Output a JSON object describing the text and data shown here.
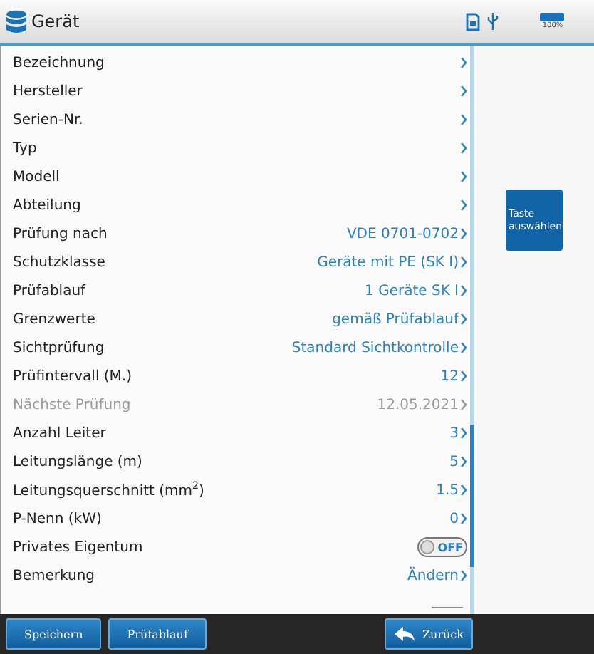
{
  "header": {
    "title": "Gerät",
    "battery": "100%"
  },
  "rows": [
    {
      "kind": "link",
      "label": "Bezeichnung",
      "value": "",
      "disabled": false
    },
    {
      "kind": "link",
      "label": "Hersteller",
      "value": "",
      "disabled": false
    },
    {
      "kind": "link",
      "label": "Serien-Nr.",
      "value": "",
      "disabled": false
    },
    {
      "kind": "link",
      "label": "Typ",
      "value": "",
      "disabled": false
    },
    {
      "kind": "link",
      "label": "Modell",
      "value": "",
      "disabled": false
    },
    {
      "kind": "link",
      "label": "Abteilung",
      "value": "",
      "disabled": false
    },
    {
      "kind": "link",
      "label": "Prüfung nach",
      "value": "VDE 0701-0702",
      "disabled": false
    },
    {
      "kind": "link",
      "label": "Schutzklasse",
      "value": "Geräte mit PE (SK I)",
      "disabled": false
    },
    {
      "kind": "link",
      "label": "Prüfablauf",
      "value": "1 Geräte SK I",
      "disabled": false
    },
    {
      "kind": "link",
      "label": "Grenzwerte",
      "value": "gemäß Prüfablauf",
      "disabled": false
    },
    {
      "kind": "link",
      "label": "Sichtprüfung",
      "value": "Standard Sichtkontrolle",
      "disabled": false
    },
    {
      "kind": "link",
      "label": "Prüfintervall (M.)",
      "value": "12",
      "disabled": false
    },
    {
      "kind": "link",
      "label": "Nächste Prüfung",
      "value": "12.05.2021",
      "disabled": true
    },
    {
      "kind": "link",
      "label": "Anzahl Leiter",
      "value": "3",
      "disabled": false
    },
    {
      "kind": "link",
      "label": "Leitungslänge (m)",
      "value": "5",
      "disabled": false
    },
    {
      "kind": "link",
      "label": "Leitungsquerschnitt (mm$^{2}$)",
      "value": "1.5",
      "disabled": false
    },
    {
      "kind": "link",
      "label": "P-Nenn (kW)",
      "value": "0",
      "disabled": false
    },
    {
      "kind": "toggle",
      "label": "Privates Eigentum",
      "value": "OFF",
      "on": false,
      "disabled": false
    },
    {
      "kind": "link",
      "label": "Bemerkung",
      "value": "Ändern",
      "disabled": false
    }
  ],
  "side_button": "Taste auswählen",
  "footer": {
    "left_buttons": [
      "Speichern",
      "Prüfablauf"
    ],
    "back_button": "Zurück"
  }
}
